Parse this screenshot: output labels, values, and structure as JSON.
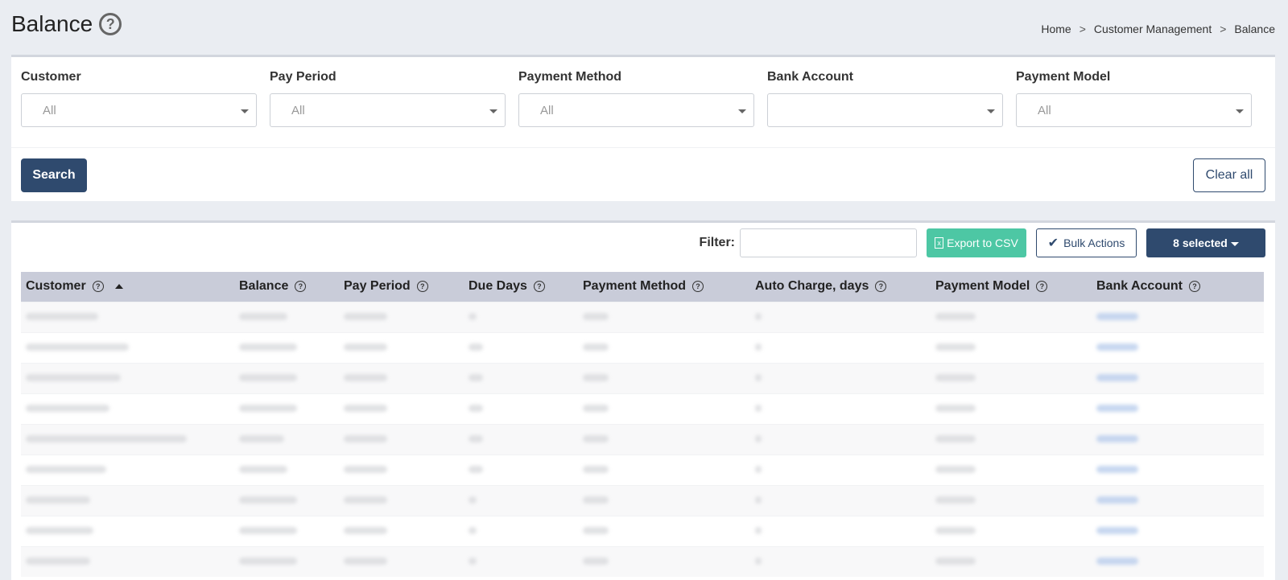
{
  "header": {
    "title": "Balance",
    "help_glyph": "?",
    "breadcrumb": [
      "Home",
      "Customer Management",
      "Balance"
    ],
    "breadcrumb_sep": ">"
  },
  "filters": {
    "items": [
      {
        "label": "Customer",
        "value": "All"
      },
      {
        "label": "Pay Period",
        "value": "All"
      },
      {
        "label": "Payment Method",
        "value": "All"
      },
      {
        "label": "Bank Account",
        "value": ""
      },
      {
        "label": "Payment Model",
        "value": "All"
      }
    ],
    "search_label": "Search",
    "clear_label": "Clear all"
  },
  "toolbar": {
    "filter_label": "Filter:",
    "filter_value": "",
    "export_label": "Export to CSV",
    "bulk_label": "Bulk Actions",
    "selected_label": "8 selected"
  },
  "table": {
    "columns": [
      "Customer",
      "Balance",
      "Pay Period",
      "Due Days",
      "Payment Method",
      "Auto Charge, days",
      "Payment Model",
      "Bank Account"
    ],
    "sorted_column": "Customer",
    "sort_direction": "ascending",
    "rows_visible": 9,
    "rows_blurred": true
  },
  "colors": {
    "primary": "#2f4a6e",
    "export_green": "#4dc7a4",
    "header_bg": "#c9ccd9",
    "page_bg": "#eaedf2"
  },
  "icons": {
    "help": "question-circle-icon",
    "export": "excel-file-icon",
    "bulk": "check-icon",
    "sort": "sort-ascending-icon",
    "select_caret": "chevron-down-icon"
  }
}
